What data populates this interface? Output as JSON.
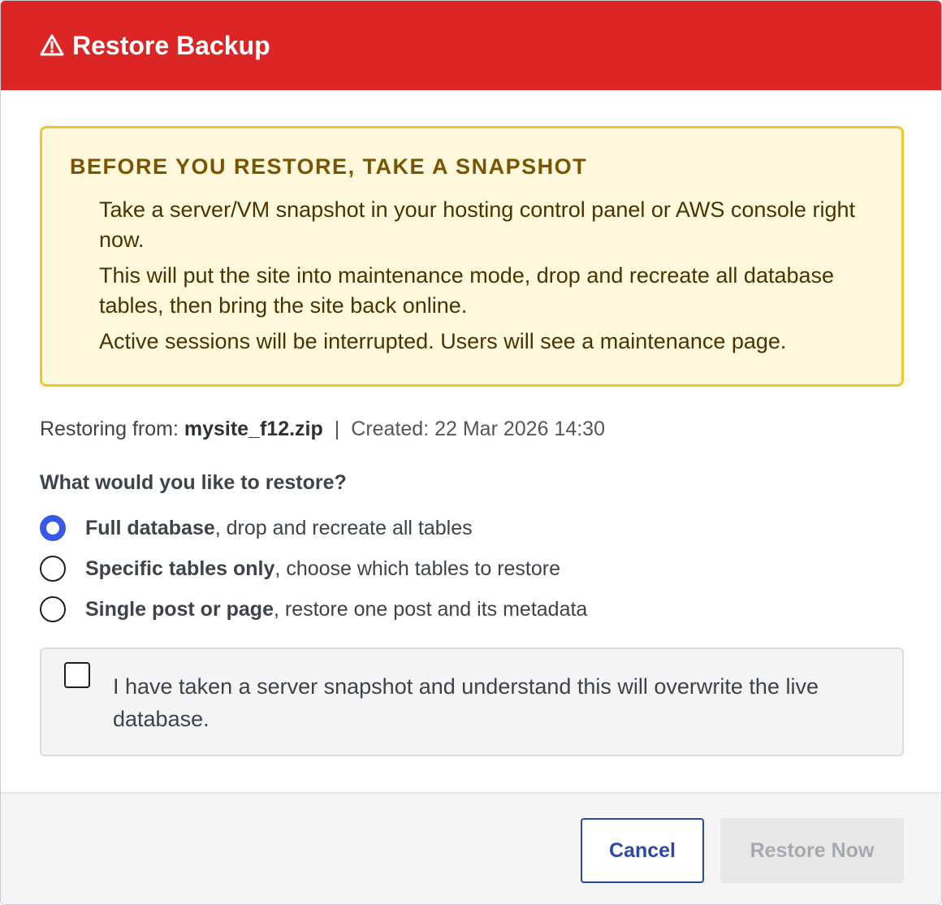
{
  "header": {
    "title": "Restore Backup",
    "icon": "warning-triangle-icon",
    "color": "#dc2626"
  },
  "warning": {
    "heading": "BEFORE YOU RESTORE, TAKE A SNAPSHOT",
    "lines": [
      "Take a server/VM snapshot in your hosting control panel or AWS console right now.",
      "This will put the site into maintenance mode, drop and recreate all database tables, then bring the site back online.",
      "Active sessions will be interrupted. Users will see a maintenance page."
    ]
  },
  "source": {
    "label": "Restoring from: ",
    "filename": "mysite_f12.zip",
    "separator": "|",
    "created": "Created: 22 Mar 2026 14:30"
  },
  "question": "What would you like to restore?",
  "options": [
    {
      "strong": "Full database",
      "rest": ", drop and recreate all tables",
      "selected": true
    },
    {
      "strong": "Specific tables only",
      "rest": ", choose which tables to restore",
      "selected": false
    },
    {
      "strong": "Single post or page",
      "rest": ", restore one post and its metadata",
      "selected": false
    }
  ],
  "confirm": {
    "text": "I have taken a server snapshot and understand this will overwrite the live database.",
    "checked": false
  },
  "footer": {
    "cancel_label": "Cancel",
    "restore_label": "Restore Now",
    "restore_disabled": true
  }
}
